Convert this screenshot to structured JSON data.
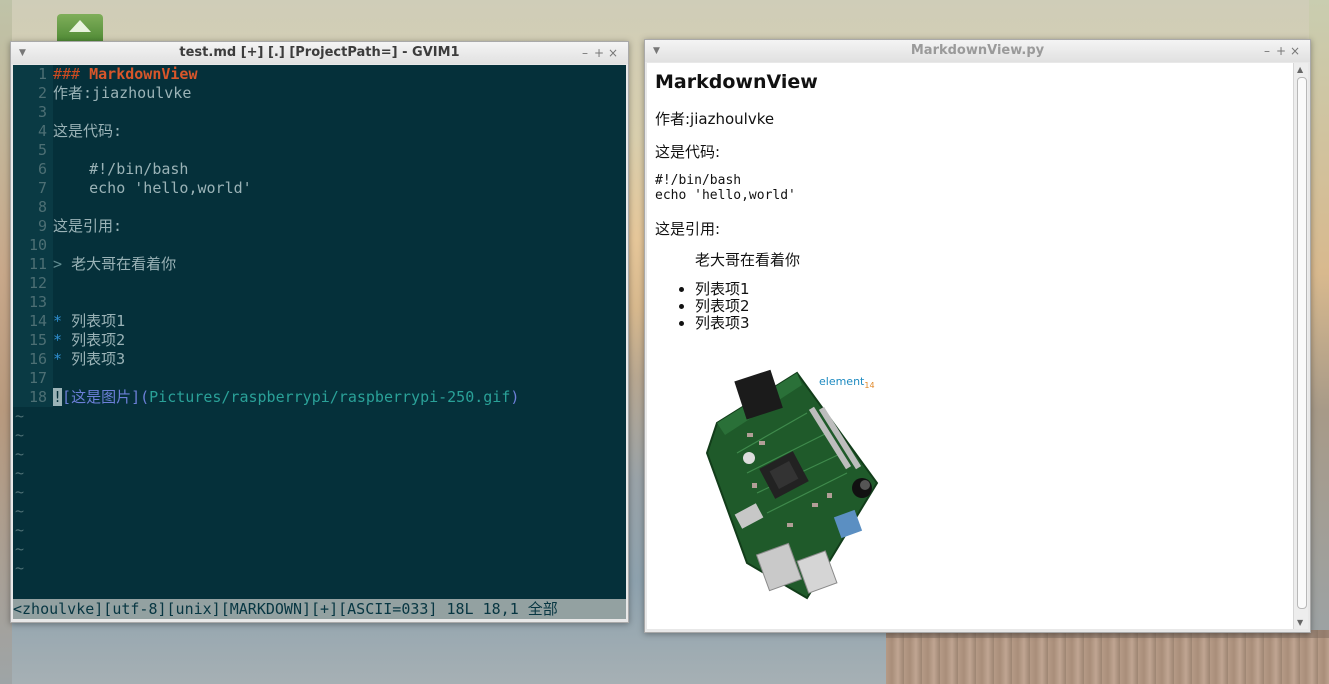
{
  "gvim": {
    "title": "test.md [+] [.] [ProjectPath=] - GVIM1",
    "lines": [
      {
        "n": "1",
        "parts": [
          {
            "t": "### ",
            "c": "c-hash"
          },
          {
            "t": "MarkdownView",
            "c": "c-title"
          }
        ]
      },
      {
        "n": "2",
        "parts": [
          {
            "t": "作者:jiazhoulvke",
            "c": ""
          }
        ]
      },
      {
        "n": "3",
        "parts": []
      },
      {
        "n": "4",
        "parts": [
          {
            "t": "这是代码:",
            "c": ""
          }
        ]
      },
      {
        "n": "5",
        "parts": []
      },
      {
        "n": "6",
        "parts": [
          {
            "t": "    #!/bin/bash",
            "c": ""
          }
        ]
      },
      {
        "n": "7",
        "parts": [
          {
            "t": "    echo 'hello,world'",
            "c": ""
          }
        ]
      },
      {
        "n": "8",
        "parts": []
      },
      {
        "n": "9",
        "parts": [
          {
            "t": "这是引用:",
            "c": ""
          }
        ]
      },
      {
        "n": "10",
        "parts": []
      },
      {
        "n": "11",
        "parts": [
          {
            "t": "> ",
            "c": "c-quote"
          },
          {
            "t": "老大哥在看着你",
            "c": ""
          }
        ]
      },
      {
        "n": "12",
        "parts": []
      },
      {
        "n": "13",
        "parts": []
      },
      {
        "n": "14",
        "parts": [
          {
            "t": "* ",
            "c": "c-bullet"
          },
          {
            "t": "列表项1",
            "c": ""
          }
        ]
      },
      {
        "n": "15",
        "parts": [
          {
            "t": "* ",
            "c": "c-bullet"
          },
          {
            "t": "列表项2",
            "c": ""
          }
        ]
      },
      {
        "n": "16",
        "parts": [
          {
            "t": "* ",
            "c": "c-bullet"
          },
          {
            "t": "列表项3",
            "c": ""
          }
        ]
      },
      {
        "n": "17",
        "parts": []
      },
      {
        "n": "18",
        "parts": [
          {
            "t": "!",
            "c": "c-cursor"
          },
          {
            "t": "[",
            "c": "c-link"
          },
          {
            "t": "这是图片",
            "c": "c-link"
          },
          {
            "t": "](",
            "c": "c-link"
          },
          {
            "t": "Pictures/raspberrypi/raspberrypi-250.gif",
            "c": "c-url"
          },
          {
            "t": ")",
            "c": "c-link"
          }
        ]
      }
    ],
    "tilde_count": 9,
    "tilde": "~",
    "statusline": "<zhoulvke][utf-8][unix][MARKDOWN][+][ASCII=033] 18L 18,1 全部"
  },
  "mdview": {
    "title": "MarkdownView.py",
    "heading": "MarkdownView",
    "author": "作者:jiazhoulvke",
    "code_label": "这是代码:",
    "code": "#!/bin/bash\necho 'hello,world'",
    "quote_label": "这是引用:",
    "quote": "老大哥在看着你",
    "list": [
      "列表项1",
      "列表项2",
      "列表项3"
    ],
    "image_brand": "element",
    "image_brand_suffix": "14"
  },
  "colors": {
    "vim_bg": "#05303a",
    "statusline_bg": "#93a1a1"
  }
}
